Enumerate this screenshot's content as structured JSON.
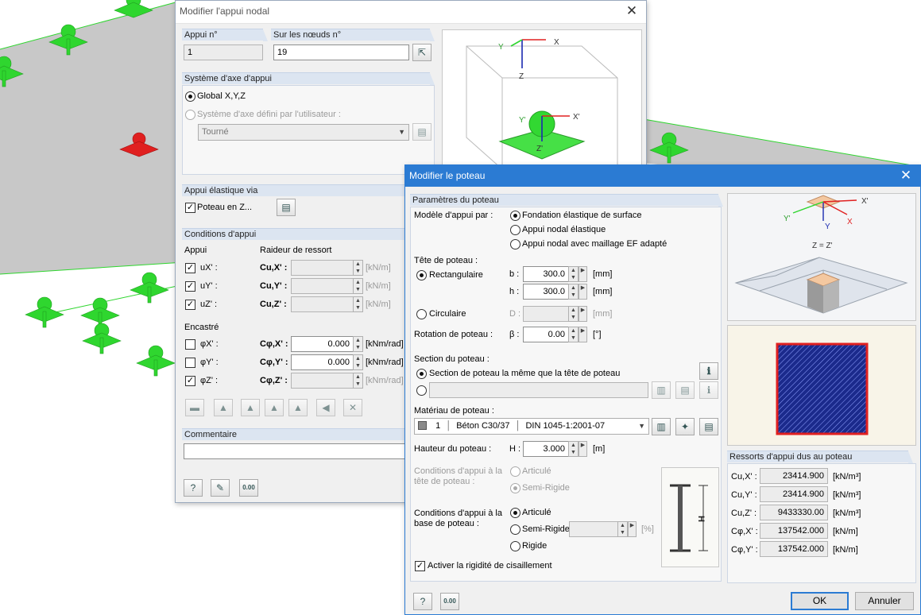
{
  "dialog_nodal": {
    "title": "Modifier l'appui nodal",
    "support_no_label": "Appui n°",
    "support_no_value": "1",
    "nodes_label": "Sur les nœuds n°",
    "nodes_value": "19",
    "axis_section": "Système d'axe d'appui",
    "axis_global": "Global X,Y,Z",
    "axis_user": "Système d'axe défini par l'utilisateur :",
    "axis_user_value": "Tourné",
    "elastic_section": "Appui élastique via",
    "elastic_column": "Poteau en Z...",
    "cond_section": "Conditions d'appui",
    "col_support": "Appui",
    "col_stiffness": "Raideur de ressort",
    "rows": [
      {
        "name": "uX' :",
        "c": "Cu,X' :",
        "value": "",
        "unit": "[kN/m]",
        "checked": true
      },
      {
        "name": "uY' :",
        "c": "Cu,Y' :",
        "value": "",
        "unit": "[kN/m]",
        "checked": true
      },
      {
        "name": "uZ' :",
        "c": "Cu,Z' :",
        "value": "",
        "unit": "[kN/m]",
        "checked": true
      }
    ],
    "fixed_label": "Encastré",
    "rot_rows": [
      {
        "name": "φX' :",
        "c": "Cφ,X' :",
        "value": "0.000",
        "unit": "[kNm/rad]",
        "checked": false
      },
      {
        "name": "φY' :",
        "c": "Cφ,Y' :",
        "value": "0.000",
        "unit": "[kNm/rad]",
        "checked": false
      },
      {
        "name": "φZ' :",
        "c": "Cφ,Z' :",
        "value": "",
        "unit": "[kNm/rad]",
        "checked": true
      }
    ],
    "comment_section": "Commentaire",
    "preview_labels": {
      "x": "X",
      "y": "Y",
      "z": "Z",
      "xp": "X'",
      "yp": "Y'",
      "zp": "Z'"
    }
  },
  "dialog_column": {
    "title": "Modifier le poteau",
    "params_section": "Paramètres du poteau",
    "model_label": "Modèle d'appui par :",
    "model_options": [
      "Fondation élastique de surface",
      "Appui nodal élastique",
      "Appui nodal avec maillage EF adapté"
    ],
    "head_label": "Tête de poteau :",
    "rect_label": "Rectangulaire",
    "b_label": "b :",
    "b_value": "300.0",
    "b_unit": "[mm]",
    "h_label": "h :",
    "h_value": "300.0",
    "h_unit": "[mm]",
    "circ_label": "Circulaire",
    "d_label": "D :",
    "d_unit": "[mm]",
    "rot_label": "Rotation de poteau :",
    "beta_label": "β :",
    "beta_value": "0.00",
    "beta_unit": "[°]",
    "section_label": "Section du poteau :",
    "section_same": "Section de poteau la même que la tête de poteau",
    "material_label": "Matériau de poteau :",
    "material_no": "1",
    "material_value": "Béton C30/37",
    "material_norm": "DIN 1045-1:2001-07",
    "height_label": "Hauteur du poteau :",
    "H_label": "H :",
    "H_value": "3.000",
    "H_unit": "[m]",
    "top_cond_label": "Conditions d'appui à la tête de poteau :",
    "top_opts": [
      "Articulé",
      "Semi-Rigide"
    ],
    "base_cond_label": "Conditions d'appui à la base de poteau :",
    "base_opts": [
      "Articulé",
      "Semi-Rigide",
      "Rigide"
    ],
    "base_semi_unit": "[%]",
    "shear_label": "Activer la rigidité de cisaillement",
    "springs_section": "Ressorts d'appui dus au poteau",
    "springs": [
      {
        "label": "Cu,X' :",
        "value": "23414.900",
        "unit": "[kN/m³]"
      },
      {
        "label": "Cu,Y' :",
        "value": "23414.900",
        "unit": "[kN/m³]"
      },
      {
        "label": "Cu,Z' :",
        "value": "9433330.00",
        "unit": "[kN/m³]"
      },
      {
        "label": "Cφ,X' :",
        "value": "137542.000",
        "unit": "[kN/m]"
      },
      {
        "label": "Cφ,Y' :",
        "value": "137542.000",
        "unit": "[kN/m]"
      }
    ],
    "preview_labels": {
      "xp": "X'",
      "x": "X",
      "yp": "Y'",
      "y": "Y",
      "zzp": "Z = Z'"
    },
    "dim_H": "H",
    "ok": "OK",
    "cancel": "Annuler"
  },
  "colors": {
    "title_blue": "#2b7bd3",
    "section": "#dce5f1",
    "support_green": "#2fd62f",
    "support_red": "#e02020",
    "hatch_blue": "#1b2a8c"
  }
}
